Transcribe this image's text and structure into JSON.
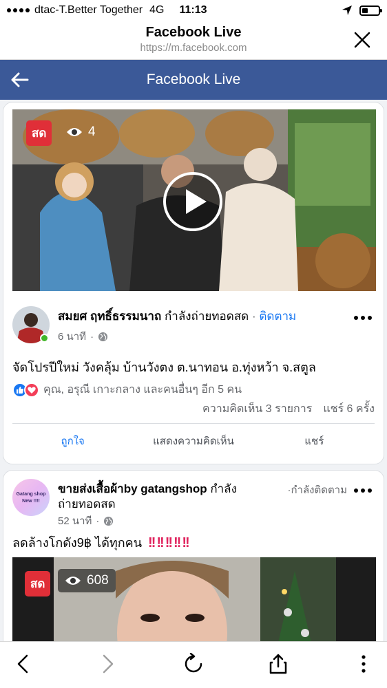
{
  "status_bar": {
    "carrier": "dtac-T.Better Together",
    "network": "4G",
    "time": "11:13",
    "battery_level": 0.35
  },
  "browser": {
    "title": "Facebook Live",
    "url": "https://m.facebook.com",
    "close_icon": "close-icon"
  },
  "fb_header": {
    "title": "Facebook Live",
    "back_icon": "back-arrow-icon",
    "color": "#3b5998"
  },
  "posts": [
    {
      "live_label": "สด",
      "viewer_count": "4",
      "author": "สมยศ ฤทธิ์ธรรมนาถ",
      "status": "กำลังถ่ายทอดสด",
      "follow_separator": "·",
      "follow_label": "ติดตาม",
      "time": "6 นาที",
      "dot": "·",
      "text": "จัดโปรปีใหม่ วังคลุ้ม บ้านวังตง ต.นาทอน อ.ทุ่งหว้า จ.สตูล",
      "reactions_text": "คุณ, อรุณี เกาะกลาง และคนอื่นๆ อีก 5 คน",
      "comments": "ความคิดเห็น 3 รายการ",
      "shares": "แชร์ 6 ครั้ง",
      "actions": {
        "like": "ถูกใจ",
        "comment": "แสดงความคิดเห็น",
        "share": "แชร์"
      }
    },
    {
      "author": "ขายส่งเสื้อผ้าby gatangshop",
      "status_line1": "กำลัง",
      "status_line2": "ถ่ายทอดสด",
      "follow_separator": "·",
      "follow_label": "กำลังติดตาม",
      "avatar_text_1": "Gatang shop",
      "avatar_text_2": "New !!!!",
      "time": "52 นาที",
      "dot": "·",
      "text": "ลดล้างโกดัง9฿ ได้ทุกคน",
      "live_label": "สด",
      "viewer_count": "608"
    }
  ],
  "toolbar": {
    "back_icon": "chevron-left-icon",
    "forward_icon": "chevron-right-icon",
    "reload_icon": "reload-icon",
    "share_icon": "share-icon",
    "more_icon": "more-vertical-icon"
  }
}
